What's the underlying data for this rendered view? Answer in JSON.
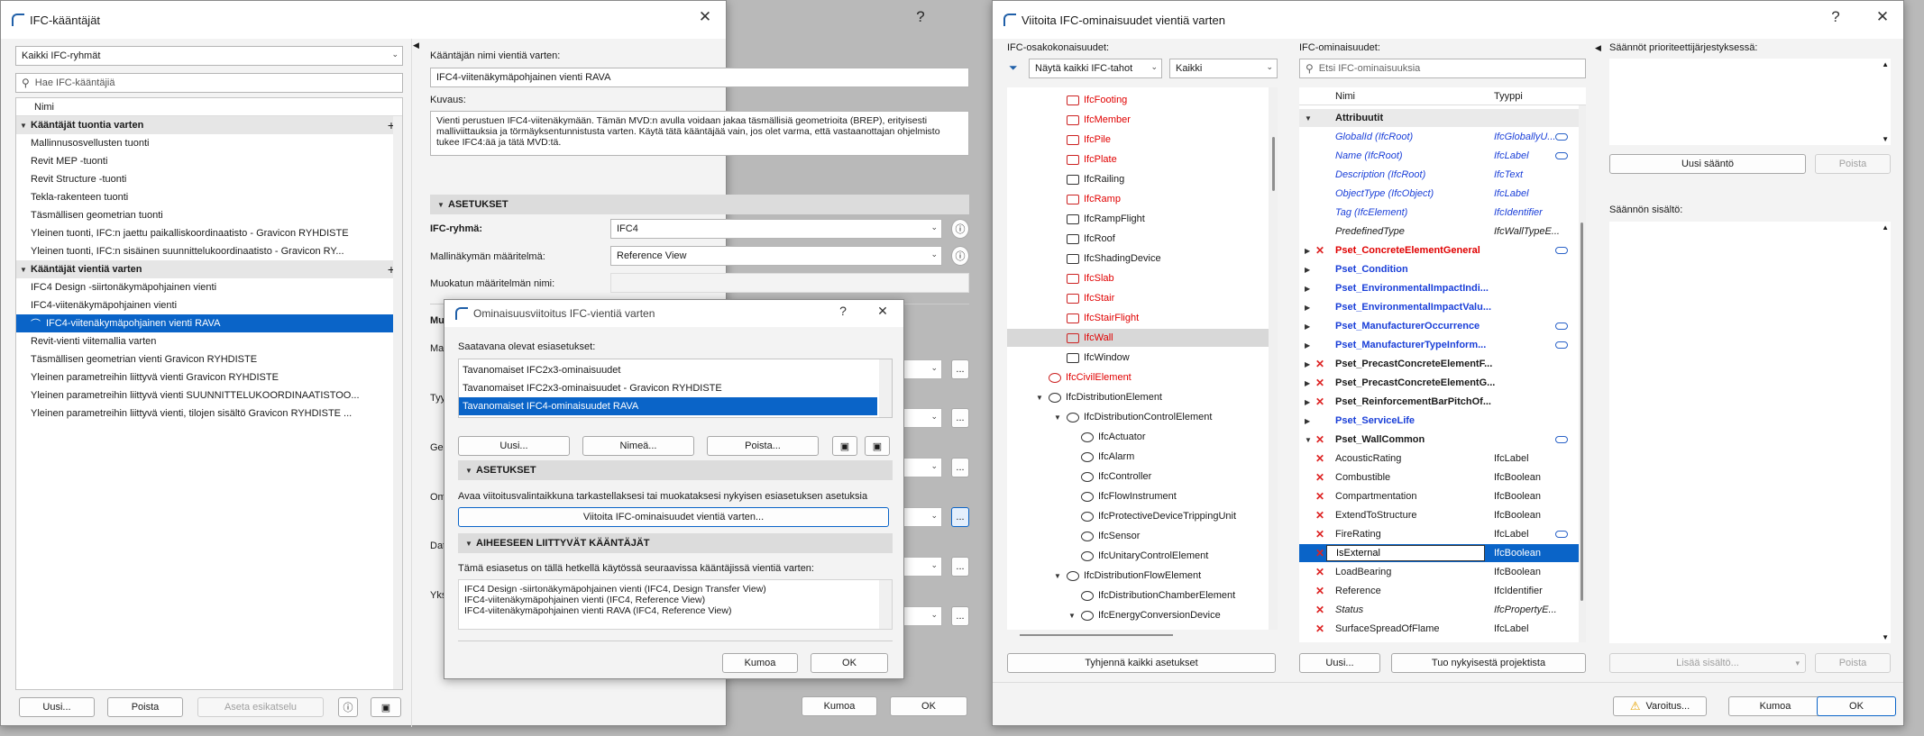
{
  "left_window": {
    "title": "IFC-kääntäjät",
    "help": "?",
    "close": "✕",
    "group_filter": "Kaikki IFC-ryhmät",
    "search_placeholder": "Hae IFC-kääntäjiä",
    "list_header": "Nimi",
    "import_section": "Kääntäjät tuontia varten",
    "import_items": [
      "Mallinnusosvellusten tuonti",
      "Revit MEP -tuonti",
      "Revit Structure -tuonti",
      "Tekla-rakenteen tuonti",
      "Täsmällisen geometrian tuonti",
      "Yleinen tuonti, IFC:n jaettu paikalliskoordinaatisto - Gravicon RYHDISTE",
      "Yleinen tuonti, IFC:n sisäinen suunnittelukoordinaatisto - Gravicon RY..."
    ],
    "export_section": "Kääntäjät vientiä varten",
    "export_items": [
      "IFC4 Design -siirtonäkymäpohjainen vienti",
      "IFC4-viitenäkymäpohjainen vienti",
      "IFC4-viitenäkymäpohjainen vienti RAVA",
      "Revit-vienti viitemallia varten",
      "Täsmällisen geometrian vienti Gravicon RYHDISTE",
      "Yleinen parametreihin liittyvä vienti Gravicon RYHDISTE",
      "Yleinen parametreihin liittyvä vienti SUUNNITTELUKOORDINAATISTOO...",
      "Yleinen parametreihin liittyvä vienti, tilojen sisältö Gravicon RYHDISTE ..."
    ],
    "selected_export_index": 2,
    "bottom_buttons": {
      "new": "Uusi...",
      "delete": "Poista",
      "set_preview": "Aseta esikatselu"
    },
    "name_label": "Kääntäjän nimi vientiä varten:",
    "name_value": "IFC4-viitenäkymäpohjainen vienti RAVA",
    "desc_label": "Kuvaus:",
    "desc_value": "Vienti perustuen IFC4-viitenäkymään. Tämän MVD:n avulla voidaan jakaa täsmällisiä geometrioita (BREP), erityisesti malliviittauksia ja törmäyksentunnistusta varten. Käytä tätä kääntäjää vain, jos olet varma, että vastaanottajan ohjelmisto tukee IFC4:ää ja tätä MVD:tä.",
    "settings_section": "ASETUKSET",
    "ifc_group_label": "IFC-ryhmä:",
    "ifc_group_value": "IFC4",
    "mvd_label": "Mallinäkymän määritelmä:",
    "mvd_value": "Reference View",
    "custom_mvd_label": "Muokatun määritelmän nimi:",
    "partial_labels": [
      "Mu",
      "Ma",
      "Tyy",
      "Ge",
      "Om",
      "Dat",
      "Yks"
    ],
    "ellipsis": "...",
    "cancel": "Kumoa",
    "ok": "OK"
  },
  "mapping_dialog": {
    "title": "Ominaisuusviitoitus IFC-vientiä varten",
    "help": "?",
    "close": "✕",
    "available_label": "Saatavana olevat esiasetukset:",
    "presets": [
      "Tavanomaiset IFC2x3-ominaisuudet",
      "Tavanomaiset IFC2x3-ominaisuudet - Gravicon RYHDISTE",
      "Tavanomaiset IFC4-ominaisuudet RAVA"
    ],
    "selected_preset_index": 2,
    "buttons": {
      "new": "Uusi...",
      "rename": "Nimeä...",
      "delete": "Poista..."
    },
    "settings_section": "ASETUKSET",
    "settings_text": "Avaa viitoitusvalintaikkuna tarkastellaksesi tai muokataksesi nykyisen esiasetuksen asetuksia",
    "map_button": "Viitoita IFC-ominaisuudet vientiä varten...",
    "related_section": "AIHEESEEN LIITTYVÄT KÄÄNTÄJÄT",
    "related_text": "Tämä esiasetus on tällä hetkellä käytössä seuraavissa kääntäjissä vientiä varten:",
    "related_items": [
      "IFC4 Design -siirtonäkymäpohjainen vienti (IFC4, Design Transfer View)",
      "IFC4-viitenäkymäpohjainen vienti (IFC4, Reference View)",
      "IFC4-viitenäkymäpohjainen vienti RAVA (IFC4, Reference View)"
    ],
    "cancel": "Kumoa",
    "ok": "OK"
  },
  "right_window": {
    "title": "Viitoita IFC-ominaisuudet vientiä varten",
    "help": "?",
    "close": "✕",
    "entities_label": "IFC-osakokonaisuudet:",
    "entity_filter": "Näytä kaikki IFC-tahot",
    "entity_filter2": "Kaikki",
    "entities": [
      {
        "name": "IfcFooting",
        "red": true,
        "indent": 0
      },
      {
        "name": "IfcMember",
        "red": true,
        "indent": 0
      },
      {
        "name": "IfcPile",
        "red": true,
        "indent": 0
      },
      {
        "name": "IfcPlate",
        "red": true,
        "indent": 0
      },
      {
        "name": "IfcRailing",
        "red": false,
        "indent": 0
      },
      {
        "name": "IfcRamp",
        "red": true,
        "indent": 0
      },
      {
        "name": "IfcRampFlight",
        "red": false,
        "indent": 0
      },
      {
        "name": "IfcRoof",
        "red": false,
        "indent": 0
      },
      {
        "name": "IfcShadingDevice",
        "red": false,
        "indent": 0
      },
      {
        "name": "IfcSlab",
        "red": true,
        "indent": 0
      },
      {
        "name": "IfcStair",
        "red": true,
        "indent": 0
      },
      {
        "name": "IfcStairFlight",
        "red": true,
        "indent": 0
      },
      {
        "name": "IfcWall",
        "red": true,
        "indent": 0,
        "highlight": true
      },
      {
        "name": "IfcWindow",
        "red": false,
        "indent": 0
      },
      {
        "name": "IfcCivilElement",
        "red": true,
        "indent": -1
      },
      {
        "name": "IfcDistributionElement",
        "red": false,
        "indent": -1,
        "expand": true
      },
      {
        "name": "IfcDistributionControlElement",
        "red": false,
        "indent": 0,
        "expand": true
      },
      {
        "name": "IfcActuator",
        "red": false,
        "indent": 1
      },
      {
        "name": "IfcAlarm",
        "red": false,
        "indent": 1
      },
      {
        "name": "IfcController",
        "red": false,
        "indent": 1
      },
      {
        "name": "IfcFlowInstrument",
        "red": false,
        "indent": 1
      },
      {
        "name": "IfcProtectiveDeviceTrippingUnit",
        "red": false,
        "indent": 1
      },
      {
        "name": "IfcSensor",
        "red": false,
        "indent": 1
      },
      {
        "name": "IfcUnitaryControlElement",
        "red": false,
        "indent": 1
      },
      {
        "name": "IfcDistributionFlowElement",
        "red": false,
        "indent": 0,
        "expand": true
      },
      {
        "name": "IfcDistributionChamberElement",
        "red": false,
        "indent": 1
      },
      {
        "name": "IfcEnergyConversionDevice",
        "red": false,
        "indent": 1,
        "expand": true
      }
    ],
    "clear_all": "Tyhjennä kaikki asetukset",
    "props_label": "IFC-ominaisuudet:",
    "props_search": "Etsi IFC-ominaisuuksia",
    "col_name": "Nimi",
    "col_type": "Tyyppi",
    "props": [
      {
        "name": "Attribuutit",
        "type": "",
        "kind": "group",
        "expander": "▼"
      },
      {
        "name": "GlobalId (IfcRoot)",
        "type": "IfcGloballyU...",
        "kind": "attr",
        "link": true
      },
      {
        "name": "Name (IfcRoot)",
        "type": "IfcLabel",
        "kind": "attr",
        "link": true
      },
      {
        "name": "Description (IfcRoot)",
        "type": "IfcText",
        "kind": "attr"
      },
      {
        "name": "ObjectType (IfcObject)",
        "type": "IfcLabel",
        "kind": "attr"
      },
      {
        "name": "Tag (IfcElement)",
        "type": "IfcIdentifier",
        "kind": "attr"
      },
      {
        "name": "PredefinedType",
        "type": "IfcWallTypeE...",
        "kind": "plain-ital"
      },
      {
        "name": "Pset_ConcreteElementGeneral",
        "type": "",
        "kind": "pset-red",
        "expander": "▶",
        "x": true,
        "link": true
      },
      {
        "name": "Pset_Condition",
        "type": "",
        "kind": "pset-blue",
        "expander": "▶"
      },
      {
        "name": "Pset_EnvironmentalImpactIndi...",
        "type": "",
        "kind": "pset-blue",
        "expander": "▶"
      },
      {
        "name": "Pset_EnvironmentalImpactValu...",
        "type": "",
        "kind": "pset-blue",
        "expander": "▶"
      },
      {
        "name": "Pset_ManufacturerOccurrence",
        "type": "",
        "kind": "pset-blue",
        "expander": "▶",
        "link": true
      },
      {
        "name": "Pset_ManufacturerTypeInform...",
        "type": "",
        "kind": "pset-blue",
        "expander": "▶",
        "link": true
      },
      {
        "name": "Pset_PrecastConcreteElementF...",
        "type": "",
        "kind": "pset-black",
        "expander": "▶",
        "x": true
      },
      {
        "name": "Pset_PrecastConcreteElementG...",
        "type": "",
        "kind": "pset-black",
        "expander": "▶",
        "x": true
      },
      {
        "name": "Pset_ReinforcementBarPitchOf...",
        "type": "",
        "kind": "pset-black",
        "expander": "▶",
        "x": true
      },
      {
        "name": "Pset_ServiceLife",
        "type": "",
        "kind": "pset-blue",
        "expander": "▶"
      },
      {
        "name": "Pset_WallCommon",
        "type": "",
        "kind": "pset-black",
        "expander": "▼",
        "x": true,
        "link": true
      },
      {
        "name": "AcousticRating",
        "type": "IfcLabel",
        "kind": "prop",
        "x": true
      },
      {
        "name": "Combustible",
        "type": "IfcBoolean",
        "kind": "prop",
        "x": true
      },
      {
        "name": "Compartmentation",
        "type": "IfcBoolean",
        "kind": "prop",
        "x": true
      },
      {
        "name": "ExtendToStructure",
        "type": "IfcBoolean",
        "kind": "prop",
        "x": true
      },
      {
        "name": "FireRating",
        "type": "IfcLabel",
        "kind": "prop",
        "x": true,
        "link": true
      },
      {
        "name": "IsExternal",
        "type": "IfcBoolean",
        "kind": "prop",
        "x": true,
        "selected": true
      },
      {
        "name": "LoadBearing",
        "type": "IfcBoolean",
        "kind": "prop",
        "x": true
      },
      {
        "name": "Reference",
        "type": "IfcIdentifier",
        "kind": "prop",
        "x": true
      },
      {
        "name": "Status",
        "type": "IfcPropertyE...",
        "kind": "prop-ital",
        "x": true
      },
      {
        "name": "SurfaceSpreadOfFlame",
        "type": "IfcLabel",
        "kind": "prop",
        "x": true
      }
    ],
    "new_btn": "Uusi...",
    "from_project_btn": "Tuo nykyisestä projektista",
    "rules_label": "Säännöt prioriteettijärjestyksessä:",
    "new_rule": "Uusi sääntö",
    "delete_rule": "Poista",
    "rule_content_label": "Säännön sisältö:",
    "add_content": "Lisää sisältö...",
    "delete_content": "Poista",
    "warnings": "Varoitus...",
    "cancel": "Kumoa",
    "ok": "OK"
  }
}
